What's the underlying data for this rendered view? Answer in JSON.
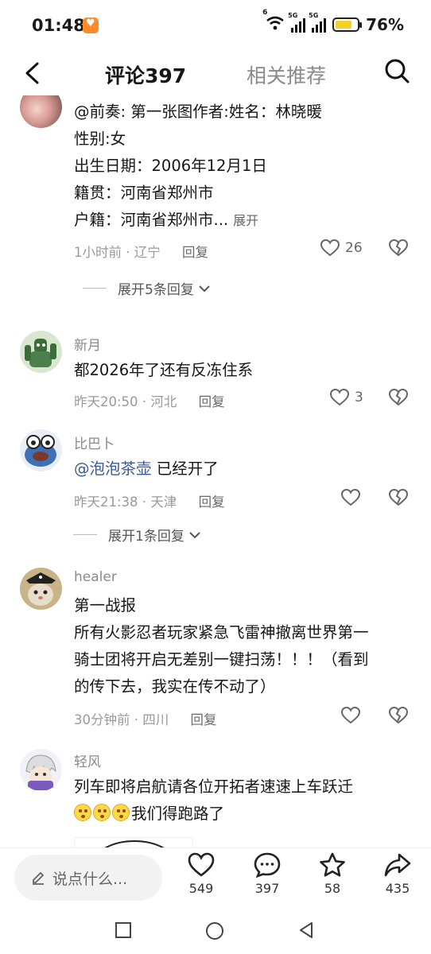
{
  "status": {
    "time": "01:48",
    "net1": "6",
    "net2": "5G",
    "net3": "5G",
    "battery": "76%"
  },
  "header": {
    "tab_comments": "评论397",
    "tab_related": "相关推荐"
  },
  "comments": [
    {
      "username": "",
      "lines": [
        "@前奏: 第一张图作者:姓名：林晓暖",
        "性别:女",
        "出生日期：2006年12月1日",
        "籍贯：河南省郑州市",
        "户籍：河南省郑州市..."
      ],
      "expand": "展开",
      "time": "1小时前",
      "location": "辽宁",
      "reply": "回复",
      "likes": "26",
      "more_replies": "展开5条回复"
    },
    {
      "username": "新月",
      "text": "都2026年了还有反冻住系",
      "time": "昨天20:50",
      "location": "河北",
      "reply": "回复",
      "likes": "3"
    },
    {
      "username": "比巴卜",
      "mention": "@泡泡茶壶",
      "text": "已经开了",
      "time": "昨天21:38",
      "location": "天津",
      "reply": "回复",
      "likes": "",
      "more_replies": "展开1条回复"
    },
    {
      "username": "healer",
      "lines": [
        "第一战报",
        "所有火影忍者玩家紧急飞雷神撤离世界第一",
        "骑士团将开启无差别一键扫荡！！！（看到",
        "的传下去，我实在传不动了）"
      ],
      "time": "30分钟前",
      "location": "四川",
      "reply": "回复",
      "likes": ""
    },
    {
      "username": "轻风",
      "line1": "列车即将启航请各位开拓者速速上车跃迁",
      "line2": "我们得跑路了",
      "emoji": [
        "flushed-emoji",
        "flushed-emoji",
        "flushed-emoji"
      ]
    }
  ],
  "bottom": {
    "placeholder": "说点什么...",
    "likes": "549",
    "comments": "397",
    "favorites": "58",
    "shares": "435"
  },
  "colors": {
    "mention": "#3a5a95",
    "meta": "#9a9a9a",
    "battery": "#f5d027"
  }
}
